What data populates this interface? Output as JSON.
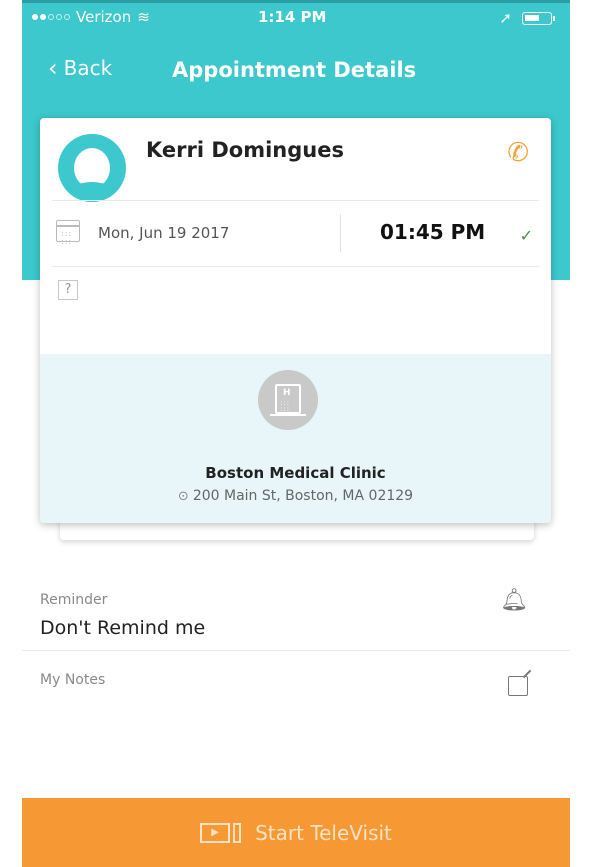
{
  "status_bar": {
    "carrier": "Verizon",
    "time": "1:14 PM"
  },
  "nav": {
    "back_label": "Back",
    "title": "Appointment Details"
  },
  "appointment": {
    "patient_name": "Kerri Domingues",
    "date": "Mon, Jun 19 2017",
    "time": "01:45 PM",
    "status_symbol": "✓",
    "unknown_placeholder": "?"
  },
  "clinic": {
    "name": "Boston Medical Clinic",
    "address": "200 Main St, Boston, MA 02129"
  },
  "reminder": {
    "label": "Reminder",
    "value": "Don't Remind me"
  },
  "notes": {
    "label": "My Notes"
  },
  "footer": {
    "button_label": "Start TeleVisit"
  },
  "icons": {
    "back": "chevron-left-icon",
    "phone": "phone-icon",
    "calendar": "calendar-icon",
    "check": "check-icon",
    "building": "hospital-building-icon",
    "pin": "location-pin-icon",
    "bell": "bell-icon",
    "edit": "edit-icon",
    "video": "video-icon"
  },
  "colors": {
    "brand_teal": "#3cc8cc",
    "accent_orange": "#f69833",
    "clinic_bg": "#e8f5f9",
    "check_green": "#3a9a3a"
  }
}
